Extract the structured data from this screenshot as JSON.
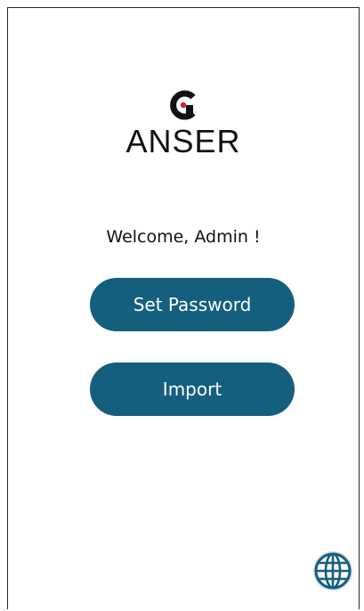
{
  "logo": {
    "text": "ANSER",
    "mark_icon": "anser-logo-mark"
  },
  "welcome": {
    "text": "Welcome, Admin !"
  },
  "buttons": {
    "set_password_label": "Set Password",
    "import_label": "Import"
  },
  "language": {
    "icon": "globe-icon"
  },
  "colors": {
    "button_bg": "#145f7e",
    "button_text": "#ffffff",
    "logo_accent": "#d8232a"
  }
}
